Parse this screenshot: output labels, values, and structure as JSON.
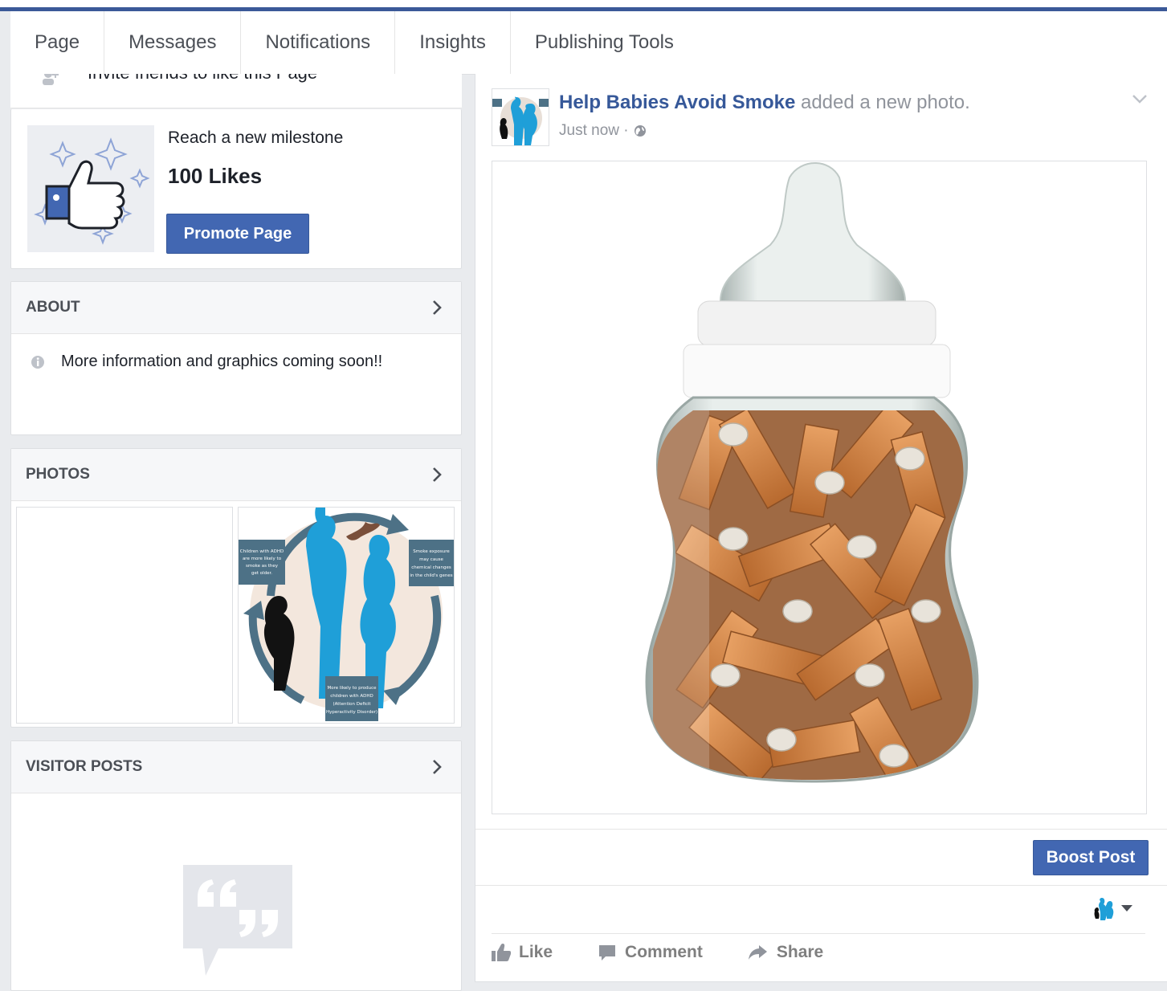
{
  "nav": {
    "tabs": [
      "Page",
      "Messages",
      "Notifications",
      "Insights",
      "Publishing Tools"
    ]
  },
  "sidebar": {
    "invite_text": "Invite friends to like this Page",
    "milestone": {
      "label": "Reach a new milestone",
      "value": "100 Likes",
      "button": "Promote Page"
    },
    "about": {
      "title": "ABOUT",
      "text": "More information and graphics coming soon!!"
    },
    "photos": {
      "title": "PHOTOS",
      "infographic": {
        "box_left": [
          "Children with ADHD",
          "are more likely to",
          "smoke as they",
          "get older."
        ],
        "box_right": [
          "Smoke exposure",
          "may cause",
          "chemical changes",
          "in the child's genes"
        ],
        "box_bottom": [
          "More likely to produce",
          "children with ADHD",
          "(Attention Deficit",
          "Hyperactivity Disorder)"
        ]
      }
    },
    "visitor_posts": {
      "title": "VISITOR POSTS"
    }
  },
  "post": {
    "page_name": "Help Babies Avoid Smoke",
    "action_text": " added a new photo.",
    "time": "Just now ·",
    "boost_button": "Boost Post",
    "actions": {
      "like": "Like",
      "comment": "Comment",
      "share": "Share"
    }
  },
  "colors": {
    "brand_blue": "#3b5998",
    "button_blue": "#4267b2",
    "link_blue": "#365899",
    "infographic_blue": "#1f9fd8",
    "infographic_slate": "#4d7186"
  }
}
